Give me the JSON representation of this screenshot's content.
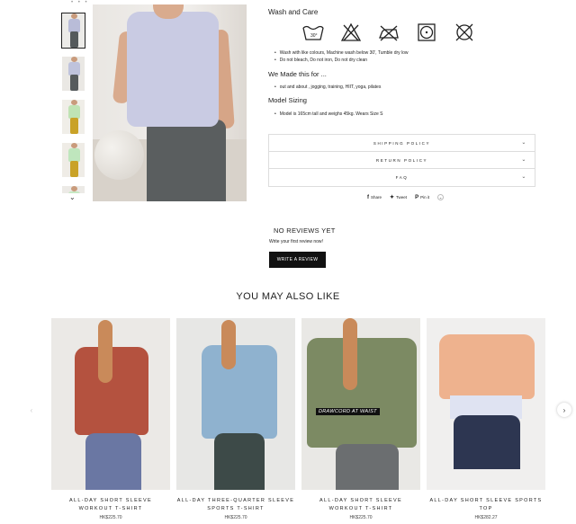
{
  "gallery": {
    "thumbnails": [
      {
        "shirt": "#b9bcd8",
        "pants": "#555a5c",
        "bg": "#ecebe8"
      },
      {
        "shirt": "#bfc3dc",
        "pants": "#565b5d",
        "bg": "#eae8e4"
      },
      {
        "shirt": "#bfe3b4",
        "pants": "#c9a227",
        "bg": "#f0eee8"
      },
      {
        "shirt": "#bfe6bd",
        "pants": "#c9a227",
        "bg": "#efece6"
      },
      {
        "shirt": "#c6e8c3",
        "pants": "#8a8c8a",
        "bg": "#eceae6"
      }
    ],
    "down_glyph": "⌄"
  },
  "care": {
    "heading": "Wash and Care",
    "icons": [
      "wash-30-icon",
      "no-bleach-icon",
      "no-iron-icon",
      "tumble-dry-low-icon",
      "no-dry-clean-icon"
    ],
    "wash_temp": "30°",
    "bullets": [
      "Wash with like colours, Machine wash below 30', Tumble dry low",
      "Do not bleach, Do not iron, Do not dry clean"
    ]
  },
  "made_for": {
    "heading": "We Made this for ...",
    "bullets": [
      "out and about , jogging, training, HIIT, yoga, pilates"
    ]
  },
  "sizing": {
    "heading": "Model Sizing",
    "bullets": [
      "Model is 165cm tall and weighs 45kg. Wears Size S"
    ]
  },
  "accordion": [
    {
      "label": "SHIPPING POLICY"
    },
    {
      "label": "RETURN POLICY"
    },
    {
      "label": "FAQ"
    }
  ],
  "share": {
    "share": "Share",
    "tweet": "Tweet",
    "pin": "Pin it"
  },
  "reviews": {
    "heading": "NO REVIEWS YET",
    "subtext": "Write your first review now!",
    "button": "WRITE A REVIEW"
  },
  "also_like": {
    "heading": "YOU MAY ALSO LIKE",
    "products": [
      {
        "title": "ALL-DAY SHORT SLEEVE WORKOUT T-SHIRT",
        "price": "HK$225.70",
        "shirt": "#b4523f",
        "legs": "#6a77a3",
        "bg": "#ebe9e6"
      },
      {
        "title": "ALL-DAY THREE-QUARTER SLEEVE SPORTS T-SHIRT",
        "price": "HK$225.70",
        "shirt": "#8fb2cf",
        "legs": "#3d4a48",
        "bg": "#e7e7e5"
      },
      {
        "title": "ALL-DAY SHORT SLEEVE WORKOUT T-SHIRT",
        "price": "HK$225.70",
        "shirt": "#7c8a63",
        "legs": "#6b6e70",
        "bg": "#e9e8e5",
        "tag": "DRAWCORD AT WAIST"
      },
      {
        "title": "ALL-DAY SHORT SLEEVE SPORTS TOP",
        "price": "HK$282.27",
        "shirt": "#eeb28e",
        "legs": "#2d3651",
        "bg": "#f0efee"
      }
    ]
  }
}
